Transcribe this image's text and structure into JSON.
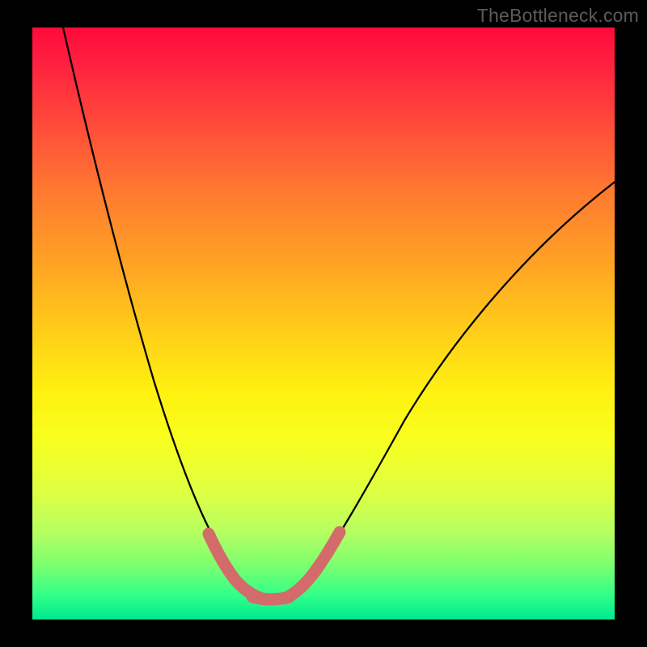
{
  "watermark": "TheBottleneck.com",
  "chart_data": {
    "type": "line",
    "title": "",
    "xlabel": "",
    "ylabel": "",
    "xlim": [
      0,
      100
    ],
    "ylim": [
      0,
      100
    ],
    "grid": false,
    "legend": false,
    "background_gradient": [
      "#ff0a3a",
      "#ff7a30",
      "#ffd018",
      "#fff210",
      "#b8ff60",
      "#00e890"
    ],
    "series": [
      {
        "name": "bottleneck-curve",
        "stroke": "#000000",
        "x": [
          5,
          8,
          12,
          16,
          20,
          24,
          28,
          32,
          34,
          36,
          38,
          40,
          42,
          44,
          46,
          50,
          56,
          62,
          68,
          76,
          84,
          92,
          100
        ],
        "values": [
          100,
          91,
          80,
          69,
          58,
          47,
          36,
          24,
          17,
          11,
          6,
          3,
          1.5,
          1,
          1.5,
          4,
          10,
          18,
          27,
          38,
          49,
          59,
          68
        ]
      },
      {
        "name": "highlight-band",
        "stroke": "#d46b6b",
        "x": [
          30,
          31.5,
          33,
          34.5,
          36,
          37.5,
          39,
          40.5,
          42,
          43.5,
          45,
          46.5,
          48,
          49.5,
          51
        ],
        "values": [
          13.5,
          10.5,
          8,
          5.8,
          4,
          2.6,
          1.6,
          1.1,
          1,
          1.2,
          1.8,
          3,
          4.8,
          7,
          9.8
        ]
      }
    ],
    "annotations": []
  }
}
